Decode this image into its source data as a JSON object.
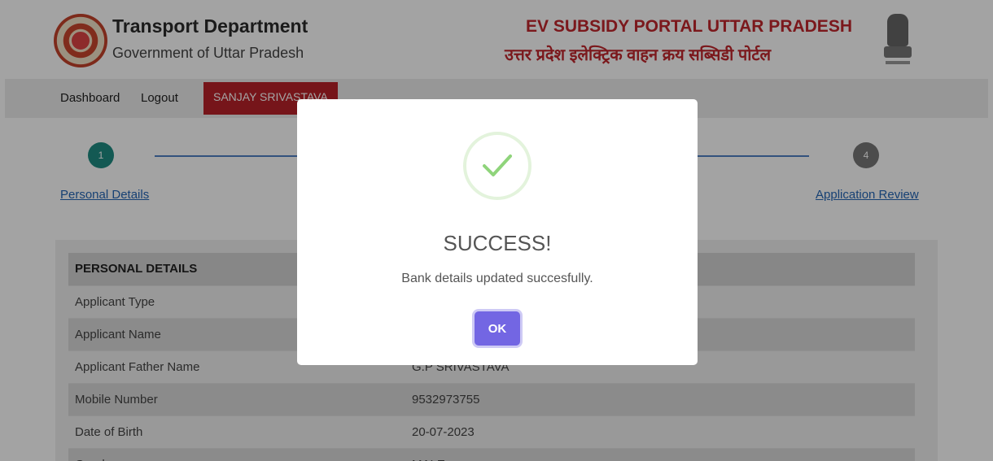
{
  "header": {
    "dept_title": "Transport Department",
    "dept_sub": "Government of Uttar Pradesh",
    "portal_title": "EV SUBSIDY PORTAL UTTAR PRADESH",
    "portal_sub": "उत्तर प्रदेश इलेक्ट्रिक वाहन क्रय सब्सिडी पोर्टल"
  },
  "nav": {
    "dashboard": "Dashboard",
    "logout": "Logout",
    "user": "SANJAY SRIVASTAVA"
  },
  "stepper": {
    "steps": [
      {
        "num": "1",
        "label": "Personal Details"
      },
      {
        "num": "4",
        "label": "Application Review"
      }
    ]
  },
  "details": {
    "heading": "PERSONAL DETAILS",
    "rows": [
      {
        "label": "Applicant Type",
        "value": ""
      },
      {
        "label": "Applicant Name",
        "value": ""
      },
      {
        "label": "Applicant Father Name",
        "value": "G.P SRIVASTAVA"
      },
      {
        "label": "Mobile Number",
        "value": "9532973755"
      },
      {
        "label": "Date of Birth",
        "value": "20-07-2023"
      },
      {
        "label": "Gender",
        "value": "MALE"
      }
    ]
  },
  "modal": {
    "title": "SUCCESS!",
    "message": "Bank details updated succesfully.",
    "ok": "OK"
  },
  "colors": {
    "brand_red": "#c0262c",
    "step_active": "#1e8c82",
    "ok_button": "#7366e3"
  }
}
